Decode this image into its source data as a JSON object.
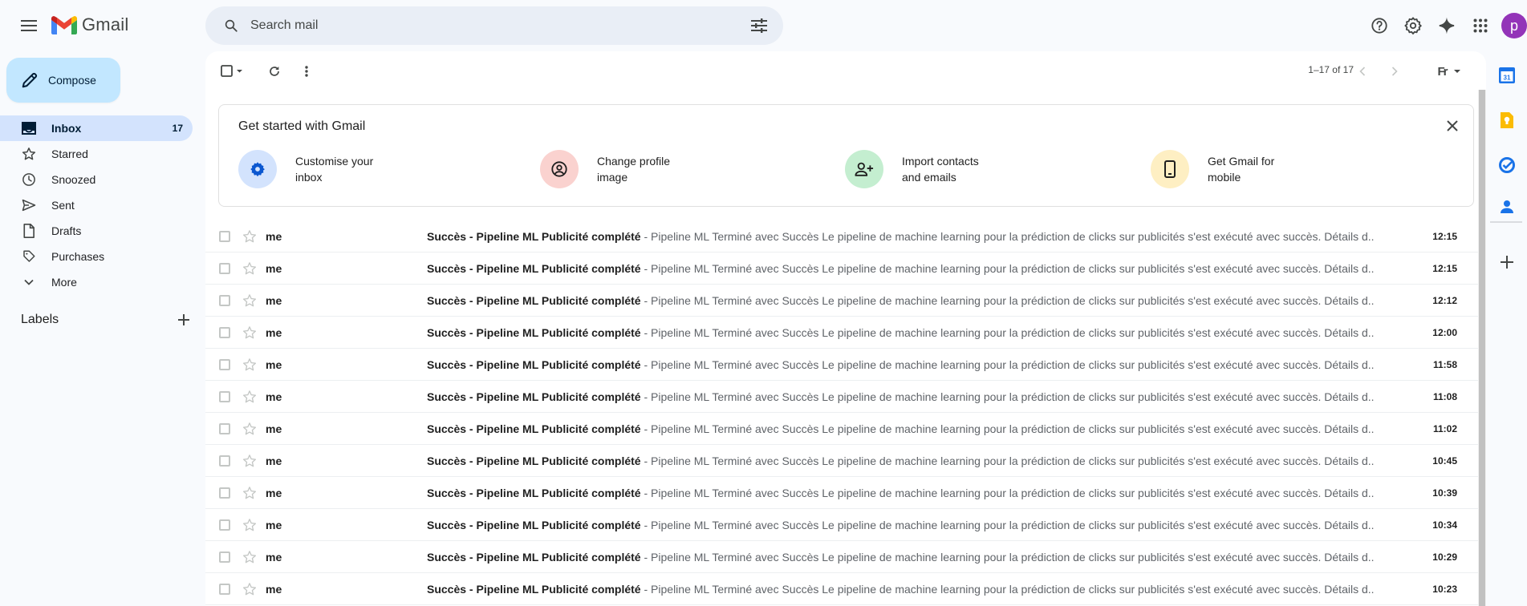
{
  "app": {
    "name": "Gmail"
  },
  "search": {
    "placeholder": "Search mail"
  },
  "header": {
    "avatar_letter": "p"
  },
  "sidebar": {
    "compose_label": "Compose",
    "items": [
      {
        "label": "Inbox",
        "count": "17",
        "icon": "inbox-icon",
        "active": true
      },
      {
        "label": "Starred",
        "count": "",
        "icon": "star-icon"
      },
      {
        "label": "Snoozed",
        "count": "",
        "icon": "clock-icon"
      },
      {
        "label": "Sent",
        "count": "",
        "icon": "send-icon"
      },
      {
        "label": "Drafts",
        "count": "",
        "icon": "draft-icon"
      },
      {
        "label": "Purchases",
        "count": "",
        "icon": "tag-icon"
      },
      {
        "label": "More",
        "count": "",
        "icon": "chevron-down-icon"
      }
    ],
    "labels_title": "Labels"
  },
  "toolbar": {
    "range": "1–17 of 17",
    "input_tool": "Fr"
  },
  "promo": {
    "title": "Get started with Gmail",
    "items": [
      {
        "line1": "Customise your",
        "line2": "inbox",
        "icon": "gear-icon",
        "color": "#d3e3fd"
      },
      {
        "line1": "Change profile",
        "line2": "image",
        "icon": "account-circle-icon",
        "color": "#fad2cf"
      },
      {
        "line1": "Import contacts",
        "line2": "and emails",
        "icon": "person-add-icon",
        "color": "#c4eed0"
      },
      {
        "line1": "Get Gmail for",
        "line2": "mobile",
        "icon": "phone-icon",
        "color": "#feefc3"
      }
    ]
  },
  "emails": [
    {
      "sender": "me",
      "subject": "Succès - Pipeline ML Publicité complété",
      "snippet": " - Pipeline ML Terminé avec Succès Le pipeline de machine learning pour la prédiction de clicks sur publicités s'est exécuté avec succès. Détails d...",
      "time": "12:15"
    },
    {
      "sender": "me",
      "subject": "Succès - Pipeline ML Publicité complété",
      "snippet": " - Pipeline ML Terminé avec Succès Le pipeline de machine learning pour la prédiction de clicks sur publicités s'est exécuté avec succès. Détails d...",
      "time": "12:15"
    },
    {
      "sender": "me",
      "subject": "Succès - Pipeline ML Publicité complété",
      "snippet": " - Pipeline ML Terminé avec Succès Le pipeline de machine learning pour la prédiction de clicks sur publicités s'est exécuté avec succès. Détails d...",
      "time": "12:12"
    },
    {
      "sender": "me",
      "subject": "Succès - Pipeline ML Publicité complété",
      "snippet": " - Pipeline ML Terminé avec Succès Le pipeline de machine learning pour la prédiction de clicks sur publicités s'est exécuté avec succès. Détails d...",
      "time": "12:00"
    },
    {
      "sender": "me",
      "subject": "Succès - Pipeline ML Publicité complété",
      "snippet": " - Pipeline ML Terminé avec Succès Le pipeline de machine learning pour la prédiction de clicks sur publicités s'est exécuté avec succès. Détails d...",
      "time": "11:58"
    },
    {
      "sender": "me",
      "subject": "Succès - Pipeline ML Publicité complété",
      "snippet": " - Pipeline ML Terminé avec Succès Le pipeline de machine learning pour la prédiction de clicks sur publicités s'est exécuté avec succès. Détails d...",
      "time": "11:08"
    },
    {
      "sender": "me",
      "subject": "Succès - Pipeline ML Publicité complété",
      "snippet": " - Pipeline ML Terminé avec Succès Le pipeline de machine learning pour la prédiction de clicks sur publicités s'est exécuté avec succès. Détails d...",
      "time": "11:02"
    },
    {
      "sender": "me",
      "subject": "Succès - Pipeline ML Publicité complété",
      "snippet": " - Pipeline ML Terminé avec Succès Le pipeline de machine learning pour la prédiction de clicks sur publicités s'est exécuté avec succès. Détails d...",
      "time": "10:45"
    },
    {
      "sender": "me",
      "subject": "Succès - Pipeline ML Publicité complété",
      "snippet": " - Pipeline ML Terminé avec Succès Le pipeline de machine learning pour la prédiction de clicks sur publicités s'est exécuté avec succès. Détails d...",
      "time": "10:39"
    },
    {
      "sender": "me",
      "subject": "Succès - Pipeline ML Publicité complété",
      "snippet": " - Pipeline ML Terminé avec Succès Le pipeline de machine learning pour la prédiction de clicks sur publicités s'est exécuté avec succès. Détails d...",
      "time": "10:34"
    },
    {
      "sender": "me",
      "subject": "Succès - Pipeline ML Publicité complété",
      "snippet": " - Pipeline ML Terminé avec Succès Le pipeline de machine learning pour la prédiction de clicks sur publicités s'est exécuté avec succès. Détails d...",
      "time": "10:29"
    },
    {
      "sender": "me",
      "subject": "Succès - Pipeline ML Publicité complété",
      "snippet": " - Pipeline ML Terminé avec Succès Le pipeline de machine learning pour la prédiction de clicks sur publicités s'est exécuté avec succès. Détails d...",
      "time": "10:23"
    }
  ],
  "side_panel": {
    "calendar_day": "31",
    "apps": [
      "calendar-icon",
      "keep-icon",
      "tasks-icon",
      "contacts-icon",
      "add-icon"
    ]
  }
}
